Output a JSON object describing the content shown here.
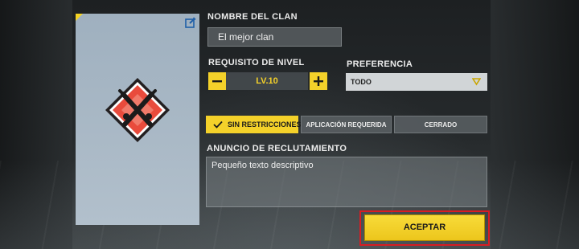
{
  "emblem": {
    "edit_icon": "edit-icon",
    "emblem_icon": "crossed-knives-emblem-icon",
    "emblem_color": "#e94b3c"
  },
  "clan_name": {
    "label": "NOMBRE DEL CLAN",
    "value": "El mejor clan"
  },
  "level_requirement": {
    "label": "REQUISITO DE NIVEL",
    "value": "LV.10",
    "minus_icon": "minus-icon",
    "plus_icon": "plus-icon"
  },
  "preference": {
    "label": "PREFERENCIA",
    "selected": "TODO",
    "chevron_icon": "chevron-down-icon"
  },
  "join_options": [
    {
      "label": "SIN RESTRICCIONES",
      "selected": true,
      "icon": "check-icon"
    },
    {
      "label": "APLICACIÓN REQUERIDA",
      "selected": false
    },
    {
      "label": "CERRADO",
      "selected": false
    }
  ],
  "announcement": {
    "label": "ANUNCIO DE RECLUTAMIENTO",
    "value": "Pequeño texto descriptivo"
  },
  "accept_button": {
    "label": "ACEPTAR"
  },
  "colors": {
    "accent": "#f4d12a",
    "highlight_outline": "#d81c23"
  }
}
